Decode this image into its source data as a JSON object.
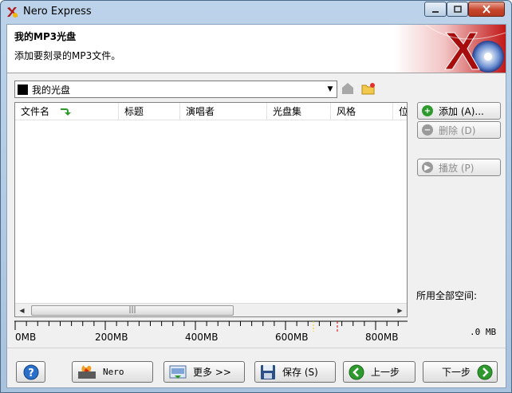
{
  "window": {
    "title": "Nero Express"
  },
  "header": {
    "title": "我的MP3光盘",
    "subtitle": "添加要刻录的MP3文件。"
  },
  "disc": {
    "name": "我的光盘"
  },
  "columns": [
    "文件名",
    "标题",
    "演唱者",
    "光盘集",
    "风格",
    "位"
  ],
  "side_buttons": {
    "add": "添加 (A)...",
    "delete": "删除 (D)",
    "play": "播放 (P)"
  },
  "space": {
    "label": "所用全部空间:",
    "value": ".0 MB"
  },
  "ruler": {
    "labels": [
      "0MB",
      "200MB",
      "400MB",
      "600MB",
      "800MB"
    ]
  },
  "bottom": {
    "help": "?",
    "nero": "Nero",
    "more": "更多 >>",
    "save": "保存 (S)",
    "back": "上一步",
    "next": "下一步"
  },
  "colors": {
    "title_bar": "#bcd3ea",
    "accent_red": "#c6452b",
    "green_button": "#2e9a2e"
  }
}
